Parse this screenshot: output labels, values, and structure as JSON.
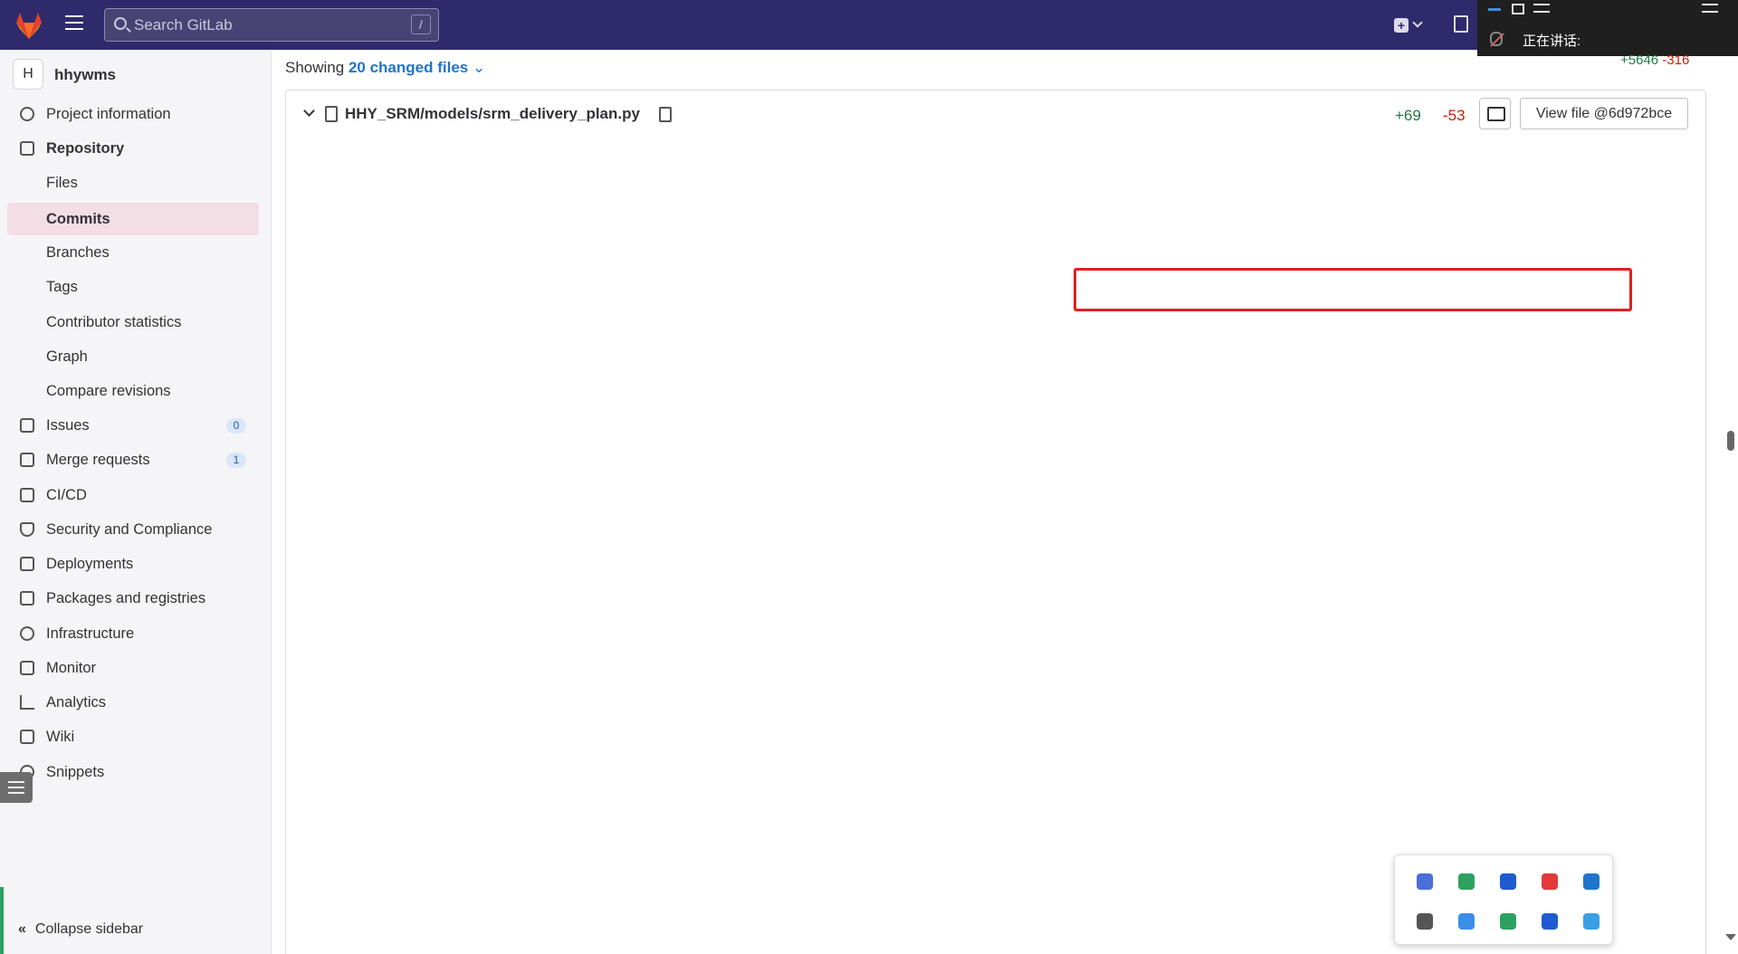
{
  "topbar": {
    "search_placeholder": "Search GitLab",
    "search_shortcut": "/",
    "overlay_speaking_label": "正在讲话:"
  },
  "sidebar": {
    "project_initial": "H",
    "project_name": "hhywms",
    "items": [
      {
        "label": "Project information",
        "icon": "info-icon"
      },
      {
        "label": "Repository",
        "icon": "repository-icon"
      },
      {
        "label": "Files"
      },
      {
        "label": "Commits"
      },
      {
        "label": "Branches"
      },
      {
        "label": "Tags"
      },
      {
        "label": "Contributor statistics"
      },
      {
        "label": "Graph"
      },
      {
        "label": "Compare revisions"
      },
      {
        "label": "Issues",
        "icon": "issues-icon",
        "badge": "0"
      },
      {
        "label": "Merge requests",
        "icon": "merge-request-icon",
        "badge": "1"
      },
      {
        "label": "CI/CD",
        "icon": "rocket-icon"
      },
      {
        "label": "Security and Compliance",
        "icon": "shield-icon"
      },
      {
        "label": "Deployments",
        "icon": "deployments-icon"
      },
      {
        "label": "Packages and registries",
        "icon": "package-icon"
      },
      {
        "label": "Infrastructure",
        "icon": "cloud-icon"
      },
      {
        "label": "Monitor",
        "icon": "monitor-icon"
      },
      {
        "label": "Analytics",
        "icon": "chart-icon"
      },
      {
        "label": "Wiki",
        "icon": "book-icon"
      },
      {
        "label": "Snippets",
        "icon": "snippet-icon"
      }
    ],
    "collapse_label": "Collapse sidebar"
  },
  "diffbar": {
    "showing_prefix": "Showing",
    "changed_files": "20 changed files",
    "overall_additions": "+5646",
    "overall_deletions": "-316"
  },
  "file": {
    "path": "HHY_SRM/models/srm_delivery_plan.py",
    "additions": "+69",
    "deletions": "-53",
    "view_file_label": "View file @6d972bce"
  },
  "colors": {
    "topbar": "#2f2a6b",
    "deleted_line": "#fbe9eb",
    "added_line": "#ecfdf0",
    "highlight_box": "#e02020"
  }
}
